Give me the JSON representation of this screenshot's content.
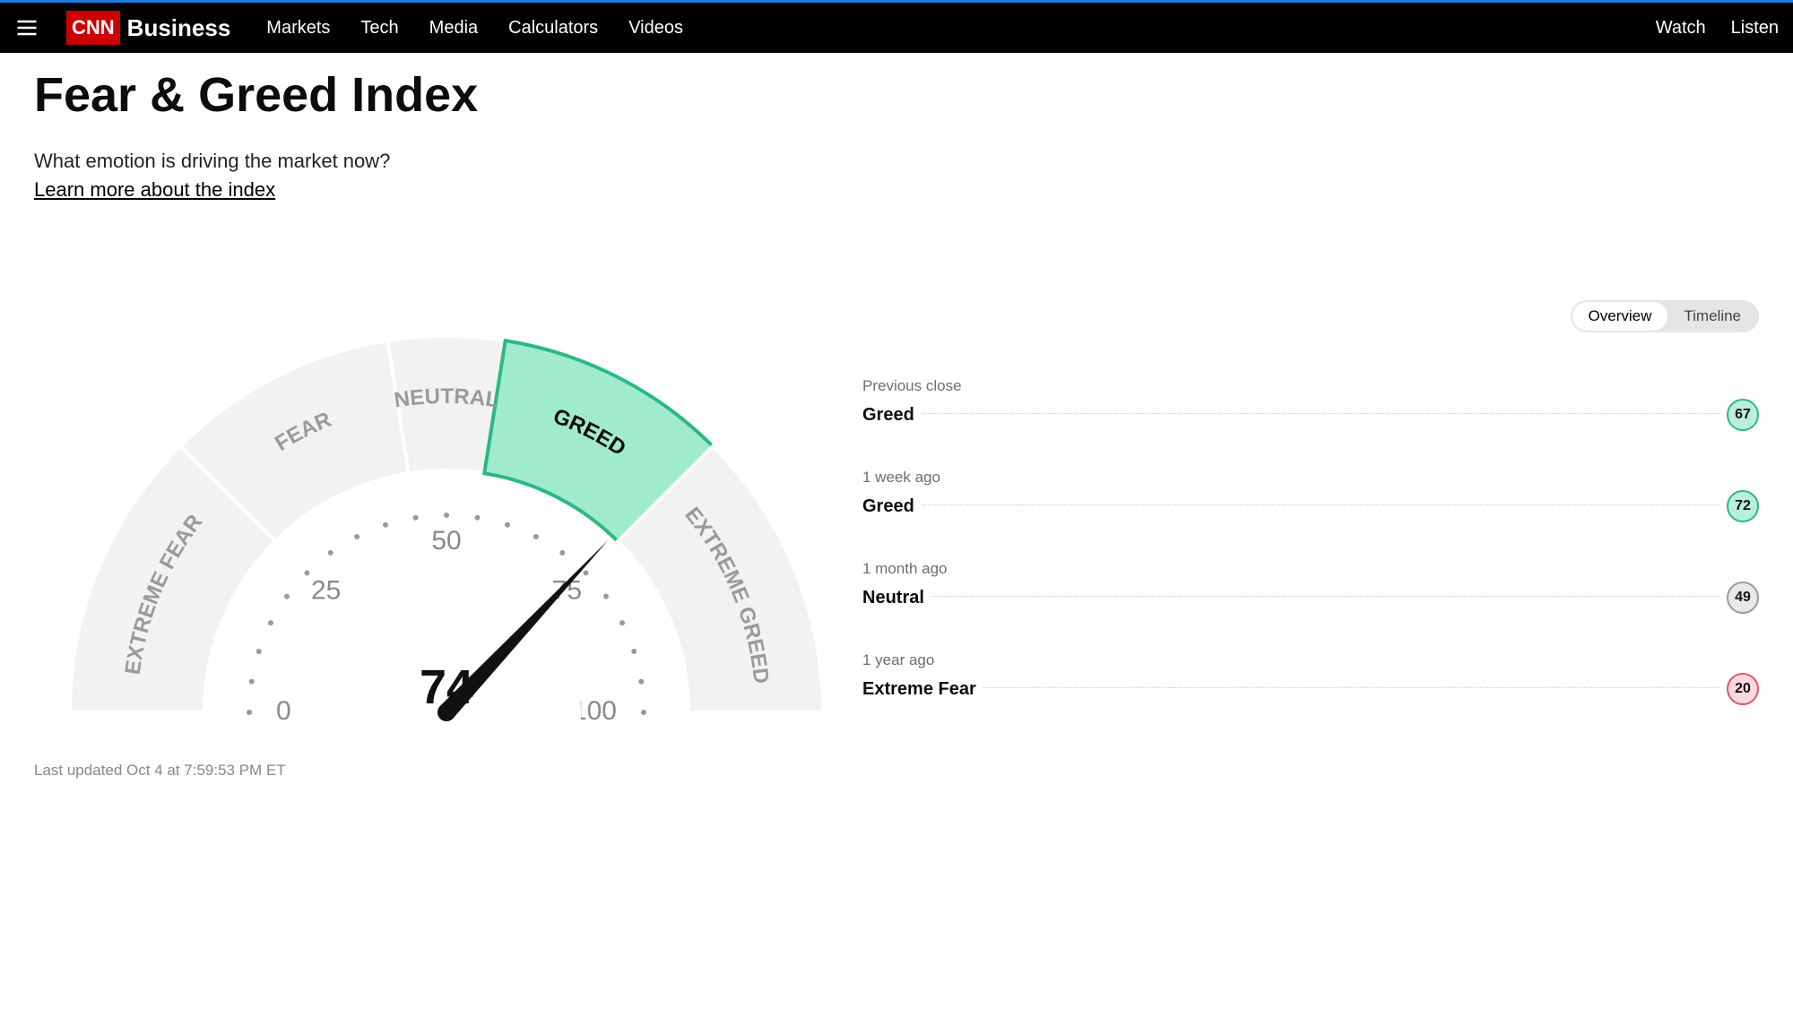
{
  "nav": {
    "logo_cnn": "CNN",
    "logo_business": "Business",
    "links": [
      "Markets",
      "Tech",
      "Media",
      "Calculators",
      "Videos"
    ],
    "right": [
      "Watch",
      "Listen"
    ]
  },
  "page": {
    "title": "Fear & Greed Index",
    "subtitle": "What emotion is driving the market now?",
    "learn_link": "Learn more about the index",
    "toggle": {
      "overview": "Overview",
      "timeline": "Timeline"
    },
    "last_updated": "Last updated Oct 4 at 7:59:53 PM ET"
  },
  "chart_data": {
    "type": "gauge",
    "title": "Fear & Greed Index",
    "value": 74,
    "range": [
      0,
      100
    ],
    "ticks": [
      0,
      25,
      50,
      75,
      100
    ],
    "segments": [
      {
        "label": "EXTREME FEAR",
        "from": 0,
        "to": 25
      },
      {
        "label": "FEAR",
        "from": 25,
        "to": 45
      },
      {
        "label": "NEUTRAL",
        "from": 45,
        "to": 55
      },
      {
        "label": "GREED",
        "from": 55,
        "to": 75
      },
      {
        "label": "EXTREME GREED",
        "from": 75,
        "to": 100
      }
    ],
    "active_segment": "GREED"
  },
  "history": [
    {
      "label": "Previous close",
      "sentiment": "Greed",
      "value": 67,
      "class": "greed"
    },
    {
      "label": "1 week ago",
      "sentiment": "Greed",
      "value": 72,
      "class": "greed"
    },
    {
      "label": "1 month ago",
      "sentiment": "Neutral",
      "value": 49,
      "class": "neutral"
    },
    {
      "label": "1 year ago",
      "sentiment": "Extreme Fear",
      "value": 20,
      "class": "efear"
    }
  ]
}
